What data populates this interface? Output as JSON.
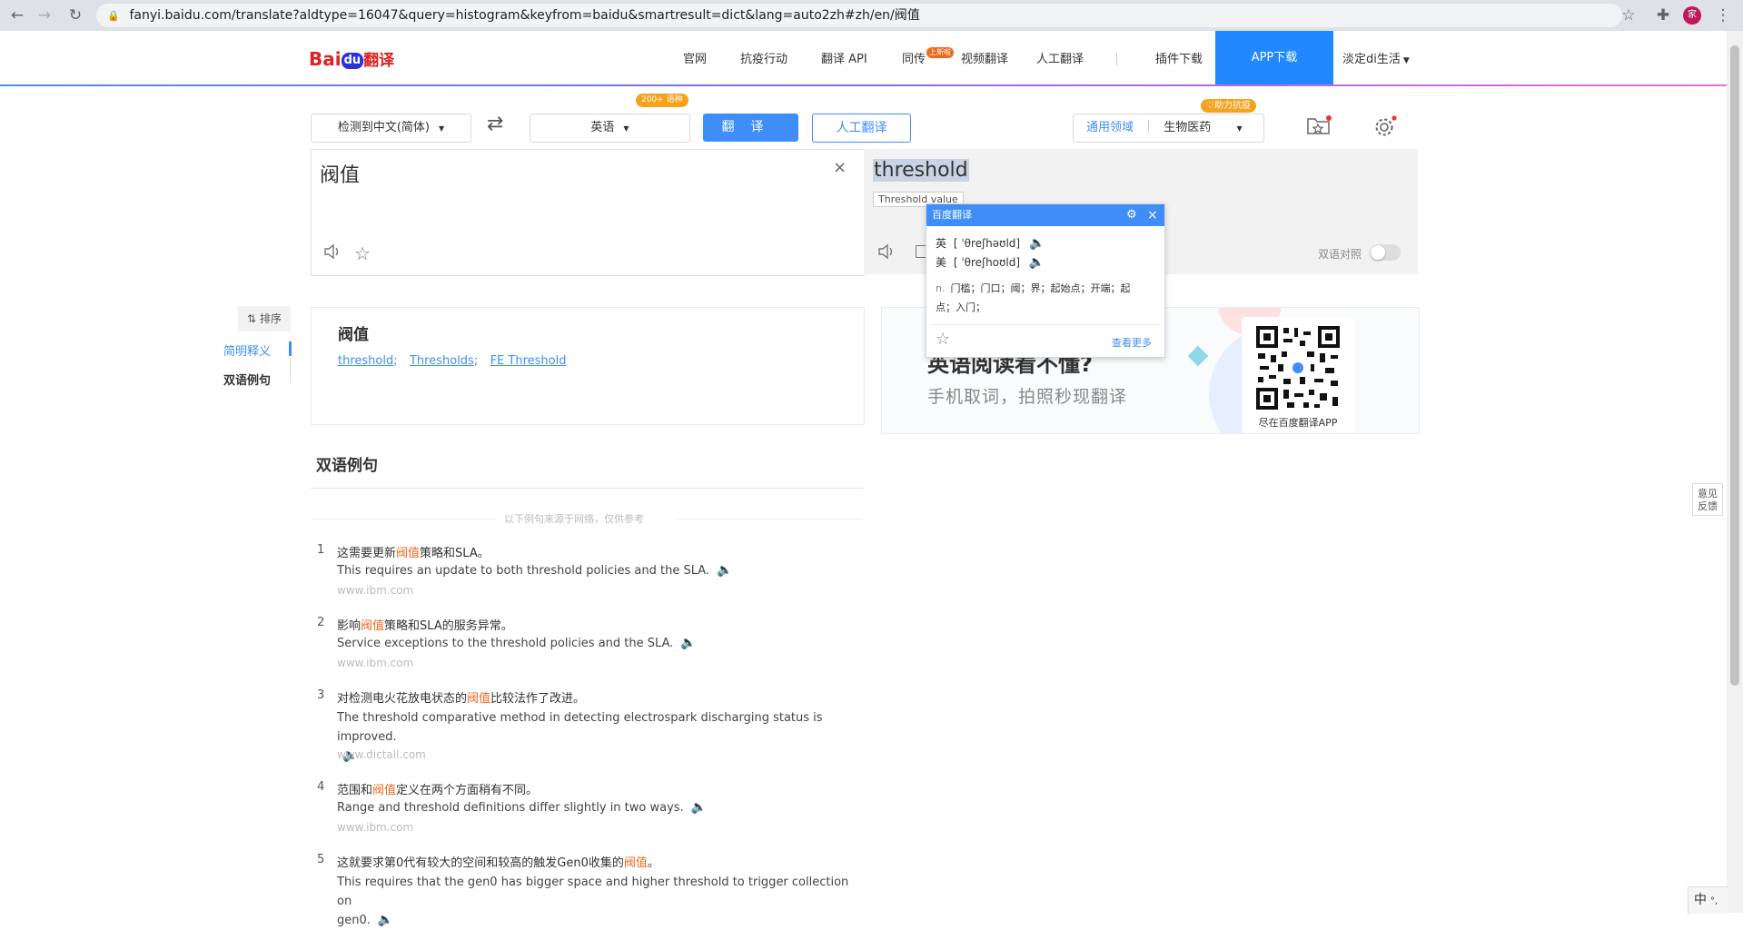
{
  "browser": {
    "url": "fanyi.baidu.com/translate?aldtype=16047&query=histogram&keyfrom=baidu&smartresult=dict&lang=auto2zh#zh/en/阀值",
    "profile_initial": "家"
  },
  "header": {
    "logo_bai": "Bai",
    "logo_du": "du",
    "logo_fanyi": "翻译",
    "nav": [
      "官网",
      "抗疫行动",
      "翻译 API",
      "同传",
      "视频翻译",
      "人工翻译",
      "插件下载"
    ],
    "new_badge": "上新啦",
    "app_download": "APP下载",
    "user": "淡定di生活"
  },
  "toolbar": {
    "source_lang": "检测到中文(简体)",
    "target_lang": "英语",
    "target_badge": "200+ 语种",
    "translate_label": "翻译",
    "human_label": "人工翻译",
    "domain_general": "通用领域",
    "domain_selected": "生物医药",
    "domain_badge": "助力抗疫"
  },
  "source": {
    "text": "阀值"
  },
  "target": {
    "text": "threshold",
    "tooltip": "Threshold value",
    "bilingual_label": "双语对照"
  },
  "popup": {
    "title": "百度翻译",
    "uk_label": "英",
    "uk_phonetic": "[ ˈθreʃhəʊld]",
    "us_label": "美",
    "us_phonetic": "[ ˈθreʃhoʊld]",
    "pos": "n.",
    "meaning": "门槛；门口；阈；界；起始点；开端；起点；入门；",
    "more": "查看更多"
  },
  "sidebar": {
    "sort": "排序",
    "items": [
      "简明释义",
      "双语例句"
    ]
  },
  "dict": {
    "word": "阀值",
    "links": [
      "threshold",
      "Thresholds",
      "FE Threshold"
    ]
  },
  "ad": {
    "headline": "英语阅读看不懂?",
    "sub": "手机取词，拍照秒现翻译",
    "qr_caption": "尽在百度翻译APP"
  },
  "examples": {
    "title": "双语例句",
    "notice": "以下例句来源于网络，仅供参考",
    "items": [
      {
        "num": "1",
        "zh_pre": "这需要更新",
        "zh_hl": "阀值",
        "zh_post": "策略和SLA。",
        "en": "This requires an update to both threshold policies and the SLA.",
        "src": "www.ibm.com"
      },
      {
        "num": "2",
        "zh_pre": "影响",
        "zh_hl": "阀值",
        "zh_post": "策略和SLA的服务异常。",
        "en": "Service exceptions to the threshold policies and the SLA.",
        "src": "www.ibm.com"
      },
      {
        "num": "3",
        "zh_pre": "对检测电火花放电状态的",
        "zh_hl": "阀值",
        "zh_post": "比较法作了改进。",
        "en": "The threshold comparative method in detecting electrospark discharging status is improved.",
        "src": "www.dictall.com"
      },
      {
        "num": "4",
        "zh_pre": "范围和",
        "zh_hl": "阀值",
        "zh_post": "定义在两个方面稍有不同。",
        "en": "Range and threshold definitions differ slightly in two ways.",
        "src": "www.ibm.com"
      },
      {
        "num": "5",
        "zh_pre": "这就要求第0代有较大的空间和较高的触发Gen0收集的",
        "zh_hl": "阀值",
        "zh_post": "。",
        "en": "This requires that the gen0 has bigger space and higher threshold to trigger collection on",
        "en2": "gen0.",
        "src": ""
      }
    ]
  },
  "feedback": "意见反馈",
  "ime": {
    "zh": "中",
    "punct": "°,"
  }
}
